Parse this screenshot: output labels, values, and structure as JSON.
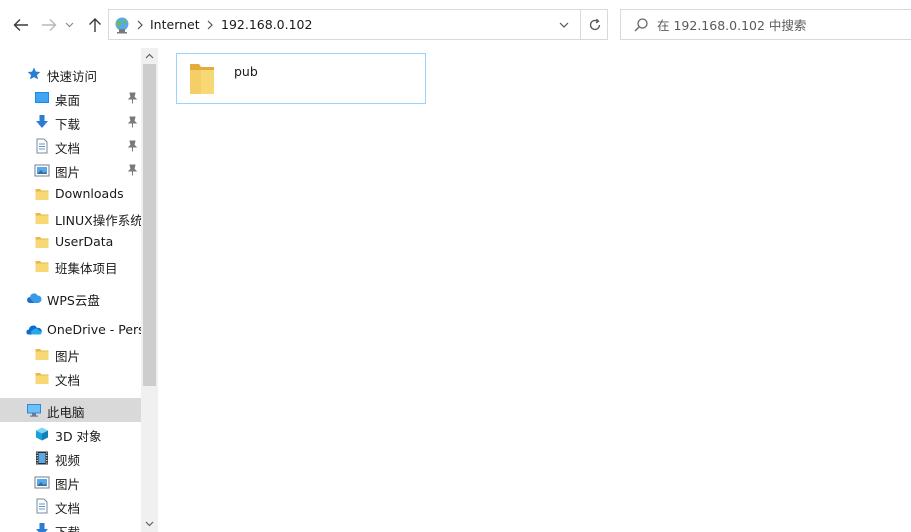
{
  "address": {
    "segments": [
      "Internet",
      "192.168.0.102"
    ]
  },
  "search": {
    "placeholder": "在 192.168.0.102 中搜索"
  },
  "sidebar": {
    "items": [
      {
        "label": "快速访问",
        "icon": "star-icon"
      },
      {
        "label": "桌面",
        "icon": "desktop-icon",
        "pinned": true
      },
      {
        "label": "下载",
        "icon": "download-icon",
        "pinned": true
      },
      {
        "label": "文档",
        "icon": "document-icon",
        "pinned": true
      },
      {
        "label": "图片",
        "icon": "picture-icon",
        "pinned": true
      },
      {
        "label": "Downloads",
        "icon": "folder-icon"
      },
      {
        "label": "LINUX操作系统",
        "icon": "folder-icon"
      },
      {
        "label": "UserData",
        "icon": "folder-icon"
      },
      {
        "label": "班集体项目",
        "icon": "folder-icon"
      },
      {
        "label": "WPS云盘",
        "icon": "cloud-icon"
      },
      {
        "label": "OneDrive - Personal",
        "icon": "onedrive-icon"
      },
      {
        "label": "图片",
        "icon": "folder-icon"
      },
      {
        "label": "文档",
        "icon": "folder-icon"
      },
      {
        "label": "此电脑",
        "icon": "computer-icon",
        "selected": true
      },
      {
        "label": "3D 对象",
        "icon": "3d-objects-icon"
      },
      {
        "label": "视频",
        "icon": "video-icon"
      },
      {
        "label": "图片",
        "icon": "picture-icon"
      },
      {
        "label": "文档",
        "icon": "document-icon"
      },
      {
        "label": "下载",
        "icon": "download-icon"
      }
    ]
  },
  "content": {
    "items": [
      {
        "name": "pub",
        "icon": "folder-icon"
      }
    ]
  },
  "colors": {
    "folder": "#f8d775",
    "selection_border": "#99d1ff",
    "sidebar_selected": "#d9d9d9",
    "accent_blue": "#1e88e5"
  }
}
